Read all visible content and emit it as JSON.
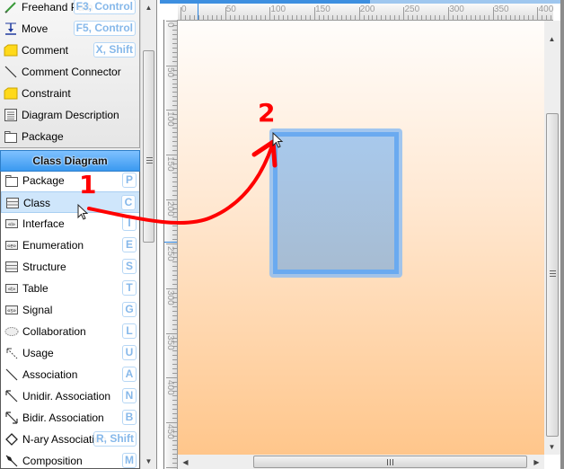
{
  "toolbox": {
    "common_items": [
      {
        "label": "Freehand Path",
        "shortcut": "F3, Control",
        "icon": "pencil-icon"
      },
      {
        "label": "Move",
        "shortcut": "F5, Control",
        "icon": "move-icon"
      },
      {
        "label": "Comment",
        "shortcut": "X, Shift",
        "icon": "comment-note-icon"
      },
      {
        "label": "Comment Connector",
        "shortcut": "",
        "icon": "line-icon"
      },
      {
        "label": "Constraint",
        "shortcut": "",
        "icon": "constraint-note-icon"
      },
      {
        "label": "Diagram Description",
        "shortcut": "",
        "icon": "description-icon"
      },
      {
        "label": "Package",
        "shortcut": "",
        "icon": "package-icon"
      }
    ],
    "section_title": "Class Diagram",
    "class_items": [
      {
        "label": "Package",
        "shortcut": "P",
        "icon": "package-icon",
        "selected": false
      },
      {
        "label": "Class",
        "shortcut": "C",
        "icon": "class-icon",
        "selected": true
      },
      {
        "label": "Interface",
        "shortcut": "I",
        "icon": "interface-icon",
        "selected": false
      },
      {
        "label": "Enumeration",
        "shortcut": "E",
        "icon": "enumeration-icon",
        "selected": false
      },
      {
        "label": "Structure",
        "shortcut": "S",
        "icon": "structure-icon",
        "selected": false
      },
      {
        "label": "Table",
        "shortcut": "T",
        "icon": "table-icon",
        "selected": false
      },
      {
        "label": "Signal",
        "shortcut": "G",
        "icon": "signal-icon",
        "selected": false
      },
      {
        "label": "Collaboration",
        "shortcut": "L",
        "icon": "collaboration-icon",
        "selected": false
      },
      {
        "label": "Usage",
        "shortcut": "U",
        "icon": "usage-icon",
        "selected": false
      },
      {
        "label": "Association",
        "shortcut": "A",
        "icon": "association-icon",
        "selected": false
      },
      {
        "label": "Unidir. Association",
        "shortcut": "N",
        "icon": "unidirectional-association-icon",
        "selected": false
      },
      {
        "label": "Bidir. Association",
        "shortcut": "B",
        "icon": "bidirectional-association-icon",
        "selected": false
      },
      {
        "label": "N-ary Association",
        "shortcut": "R, Shift",
        "icon": "nary-association-icon",
        "selected": false
      },
      {
        "label": "Composition",
        "shortcut": "M",
        "icon": "composition-icon",
        "selected": false
      }
    ]
  },
  "rulers": {
    "horizontal": [
      "0",
      "50",
      "100",
      "150",
      "200",
      "250",
      "300",
      "350",
      "400"
    ],
    "vertical": [
      "0",
      "50",
      "100",
      "150",
      "200",
      "250",
      "300",
      "350",
      "400",
      "450"
    ]
  },
  "annotations": {
    "step1": "1",
    "step2": "2",
    "arrow_color": "#ff0000"
  },
  "canvas": {
    "shape": "class-placeholder",
    "shape_color": "#6aaaf0"
  }
}
